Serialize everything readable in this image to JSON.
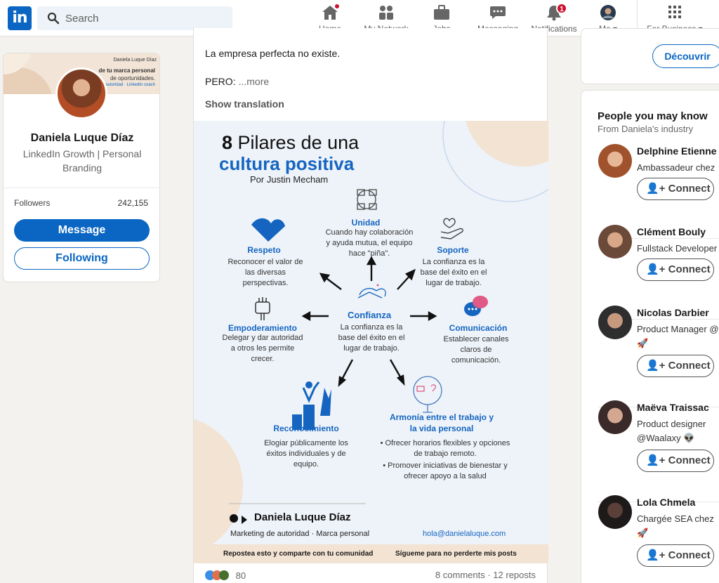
{
  "nav": {
    "logo": "in",
    "search_placeholder": "Search",
    "items": [
      {
        "label": "Home",
        "badge": "",
        "icon": "home-icon"
      },
      {
        "label": "My Network",
        "badge": "",
        "icon": "network-icon"
      },
      {
        "label": "Jobs",
        "badge": "",
        "icon": "briefcase-icon"
      },
      {
        "label": "Messaging",
        "badge": "",
        "icon": "chat-icon"
      },
      {
        "label": "Notifications",
        "badge": "1",
        "icon": "bell-icon"
      },
      {
        "label": "Me",
        "badge": "",
        "icon": "avatar-icon"
      },
      {
        "label": "For Business",
        "badge": "",
        "icon": "grid-icon"
      }
    ]
  },
  "profile": {
    "name": "Daniela Luque Díaz",
    "headline": "LinkedIn Growth | Personal Branding",
    "banner_brand": "Daniela Luque Díaz",
    "banner_line1": "de tu marca personal",
    "banner_line2": "de oportunidades.",
    "banner_line3": "de autoridad · LinkedIn coach",
    "followers_label": "Followers",
    "followers_count": "242,155",
    "message_label": "Message",
    "following_label": "Following"
  },
  "post": {
    "line1": "La empresa perfecta no existe.",
    "line2": "PERO:",
    "more": "...more",
    "show_translation": "Show translation",
    "reaction_count": "80",
    "comments": "8 comments",
    "reposts": "12 reposts"
  },
  "infographic": {
    "title_num": "8",
    "title_rest": "Pilares de una",
    "title_line2": "cultura positiva",
    "author": "Por Justin Mecham",
    "center_title": "Confianza",
    "center_desc": "La confianza es la base del éxito en el lugar de trabajo.",
    "pillars": {
      "unidad": {
        "title": "Unidad",
        "desc": "Cuando hay colaboración y ayuda mutua, el equipo hace \"piña\"."
      },
      "respeto": {
        "title": "Respeto",
        "desc": "Reconocer el valor de las diversas perspectivas."
      },
      "soporte": {
        "title": "Soporte",
        "desc": "La confianza es la base del éxito en el lugar de trabajo."
      },
      "empoderamiento": {
        "title": "Empoderamiento",
        "desc": "Delegar y dar autoridad a otros les permite crecer."
      },
      "comunicacion": {
        "title": "Comunicación",
        "desc": "Establecer canales claros de comunicación."
      },
      "reconocimiento": {
        "title": "Reconocimiento",
        "desc": "Elogiar públicamente los éxitos individuales y de equipo."
      },
      "armonia": {
        "title": "Armonía entre el trabajo y la vida personal",
        "bullet1": "Ofrecer horarios flexibles y opciones de trabajo remoto.",
        "bullet2": "Promover iniciativas de bienestar y ofrecer apoyo a la salud"
      }
    },
    "sign_name": "Daniela Luque Díaz",
    "sign_role": "Marketing de autoridad · Marca personal",
    "sign_email": "hola@danielaluque.com",
    "footer_left": "Repostea esto y comparte con tu comunidad",
    "footer_right": "Sígueme para no perderte mis posts"
  },
  "right": {
    "discover_label": "Découvrir",
    "pymk_title": "People you may know",
    "pymk_sub": "From Daniela's industry",
    "connect_label": "Connect",
    "people": [
      {
        "name": "Delphine Etienne",
        "title": "Ambassadeur chez",
        "title2": ""
      },
      {
        "name": "Clément Bouly",
        "title": "Fullstack Developer",
        "title2": ""
      },
      {
        "name": "Nicolas Darbier",
        "title": "Product Manager @",
        "title2": "🚀"
      },
      {
        "name": "Maëva Traissac",
        "title": "Product designer",
        "title2": "@Waalaxy 👽"
      },
      {
        "name": "Lola Chmela",
        "title": "Chargée SEA chez",
        "title2": "🚀"
      }
    ]
  },
  "colors": {
    "brand": "#0a66c2",
    "badge": "#cb112d",
    "infographic_blue": "#1565c0",
    "infographic_peach": "#f3e3d3"
  }
}
